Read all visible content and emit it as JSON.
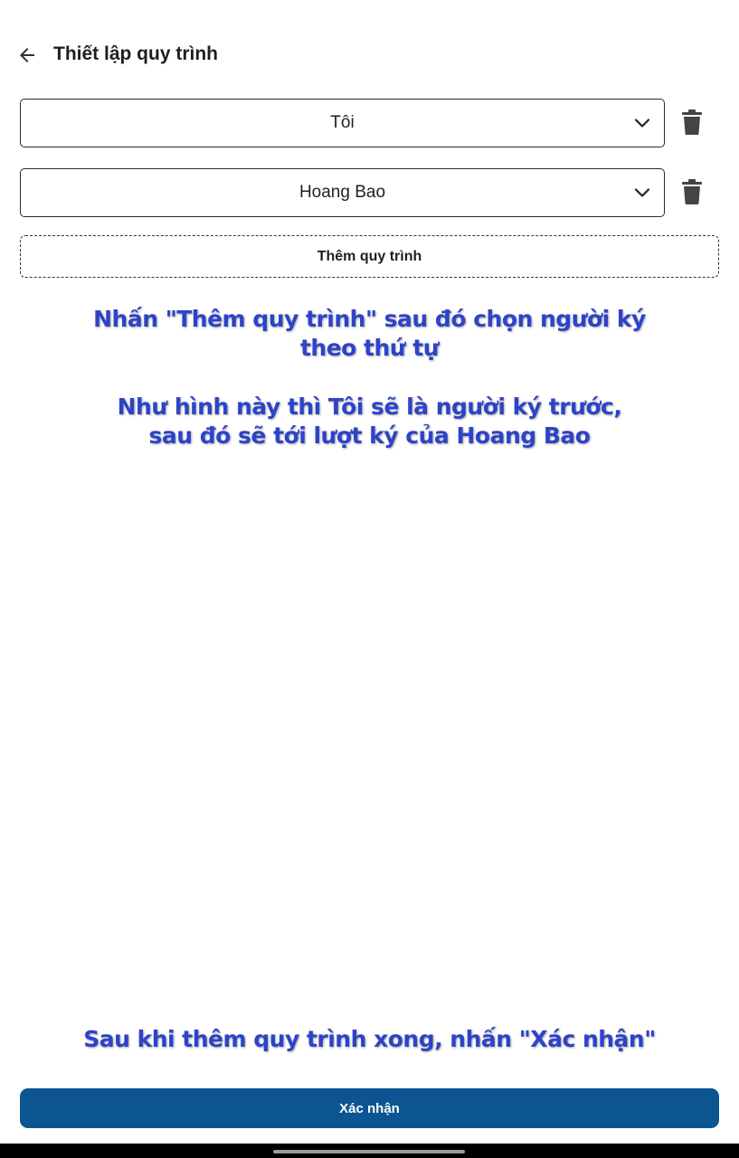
{
  "header": {
    "title": "Thiết lập quy trình",
    "back_icon": "arrow-left-icon"
  },
  "steps": [
    {
      "value": "Tôi",
      "dropdown_icon": "chevron-down-icon",
      "delete_icon": "trash-icon"
    },
    {
      "value": "Hoang Bao",
      "dropdown_icon": "chevron-down-icon",
      "delete_icon": "trash-icon"
    }
  ],
  "add_step_label": "Thêm quy trình",
  "annotations": {
    "line1": "Nhấn \"Thêm quy trình\" sau đó chọn người ký",
    "line2": "theo thứ tự",
    "line3": "Như hình này thì Tôi sẽ là người ký trước,",
    "line4": "sau đó sẽ tới lượt ký của Hoang Bao",
    "line5": "Sau khi thêm quy trình xong, nhấn \"Xác nhận\""
  },
  "confirm_label": "Xác nhận",
  "colors": {
    "primary": "#0d5592",
    "annotation": "#2d43c9"
  }
}
